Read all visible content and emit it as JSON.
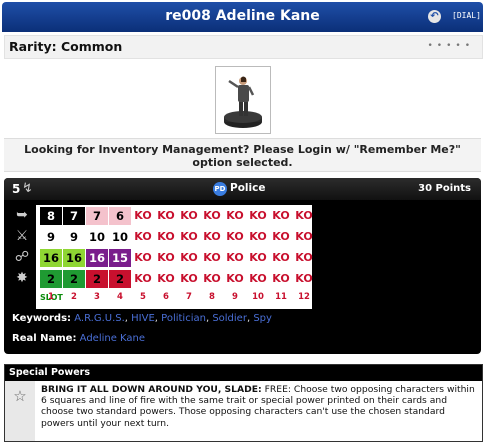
{
  "title": "re008 Adeline Kane",
  "dial_label": "[DIAL]",
  "rarity": "Rarity: Common",
  "inventory_message": "Looking for Inventory Management? Please Login w/ \"Remember Me?\" option selected.",
  "header": {
    "range": "5",
    "team_icon": "PD",
    "team": "Police",
    "points": "30 Points"
  },
  "dial": {
    "rows": [
      [
        "8",
        "7",
        "7",
        "6",
        "KO",
        "KO",
        "KO",
        "KO",
        "KO",
        "KO",
        "KO",
        "KO"
      ],
      [
        "9",
        "9",
        "10",
        "10",
        "KO",
        "KO",
        "KO",
        "KO",
        "KO",
        "KO",
        "KO",
        "KO"
      ],
      [
        "16",
        "16",
        "16",
        "15",
        "KO",
        "KO",
        "KO",
        "KO",
        "KO",
        "KO",
        "KO",
        "KO"
      ],
      [
        "2",
        "2",
        "2",
        "2",
        "KO",
        "KO",
        "KO",
        "KO",
        "KO",
        "KO",
        "KO",
        "KO"
      ]
    ],
    "slot_label": "SLOT",
    "slots": [
      "1",
      "2",
      "3",
      "4",
      "5",
      "6",
      "7",
      "8",
      "9",
      "10",
      "11",
      "12"
    ]
  },
  "keywords_label": "Keywords:",
  "keywords": [
    "A.R.G.U.S.",
    "HIVE",
    "Politician",
    "Soldier",
    "Spy"
  ],
  "real_name_label": "Real Name:",
  "real_name": "Adeline Kane",
  "special_powers": {
    "title": "Special Powers",
    "power_name": "BRING IT ALL DOWN AROUND YOU, SLADE:",
    "power_text": "FREE: Choose two opposing characters within 6 squares and line of fire with the same trait or special power printed on their cards and choose two standard powers. Those opposing characters can't use the chosen standard powers until your next turn."
  },
  "colors": {
    "title_bar": "#1f4fa8",
    "ko": "#c8102e",
    "link": "#4a6fd6"
  }
}
